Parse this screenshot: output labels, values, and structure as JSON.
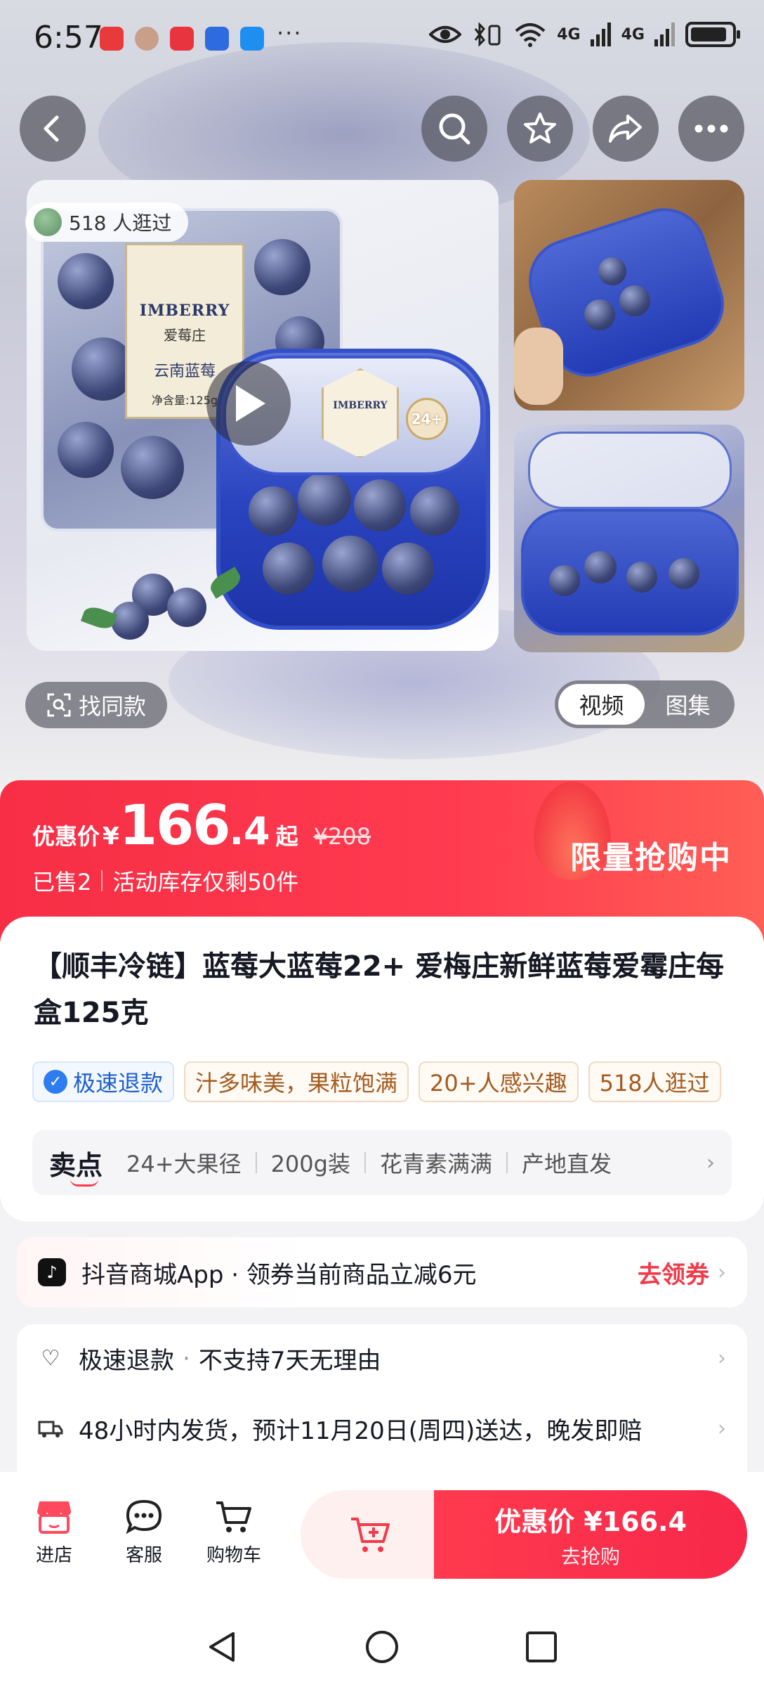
{
  "status_bar": {
    "time": "6:57",
    "signal_1": "4G",
    "signal_2": "4G",
    "overflow": "···"
  },
  "header": {
    "back_icon": "back-arrow-icon",
    "search_icon": "search-icon",
    "favorite_icon": "star-icon",
    "share_icon": "share-icon",
    "more_icon": "more-icon"
  },
  "gallery": {
    "visitors_badge": "518 人逛过",
    "product_label_brand": "IMBERRY",
    "product_label_cn": "爱莓庄",
    "product_label_name": "云南蓝莓",
    "product_label_weight": "净含量:125g",
    "box_brand": "IMBERRY",
    "size_badge": "24+",
    "find_same": "找同款",
    "tab_video": "视频",
    "tab_album": "图集"
  },
  "price": {
    "label": "优惠价",
    "currency": "¥",
    "integer": "166",
    "decimal": ".4",
    "suffix": "起",
    "original": "¥208",
    "sold": "已售2",
    "stock": "活动库存仅剩50件",
    "limited": "限量抢购中"
  },
  "product": {
    "title": "【顺丰冷链】蓝莓大蓝莓22+ 爱梅庄新鲜蓝莓爱霉庄每盒125克",
    "tags": [
      "极速退款",
      "汁多味美，果粒饱满",
      "20+人感兴趣",
      "518人逛过"
    ],
    "selling_points_title": "卖点",
    "selling_points": [
      "24+大果径",
      "200g装",
      "花青素满满",
      "产地直发"
    ]
  },
  "coupon": {
    "text": "抖音商城App · 领券当前商品立减6元",
    "action": "去领券"
  },
  "service": {
    "row1_main": "极速退款",
    "row1_sub": "不支持7天无理由",
    "row2": "48小时内发货，预计11月20日(周四)送达，晚发即赔"
  },
  "bottom_bar": {
    "store": "进店",
    "service": "客服",
    "cart": "购物车",
    "buy_main": "优惠价 ¥166.4",
    "buy_sub": "去抢购"
  },
  "colors": {
    "accent": "#ff3b50",
    "tag_text": "#a35a1e",
    "refund_blue": "#2d7cf0"
  }
}
